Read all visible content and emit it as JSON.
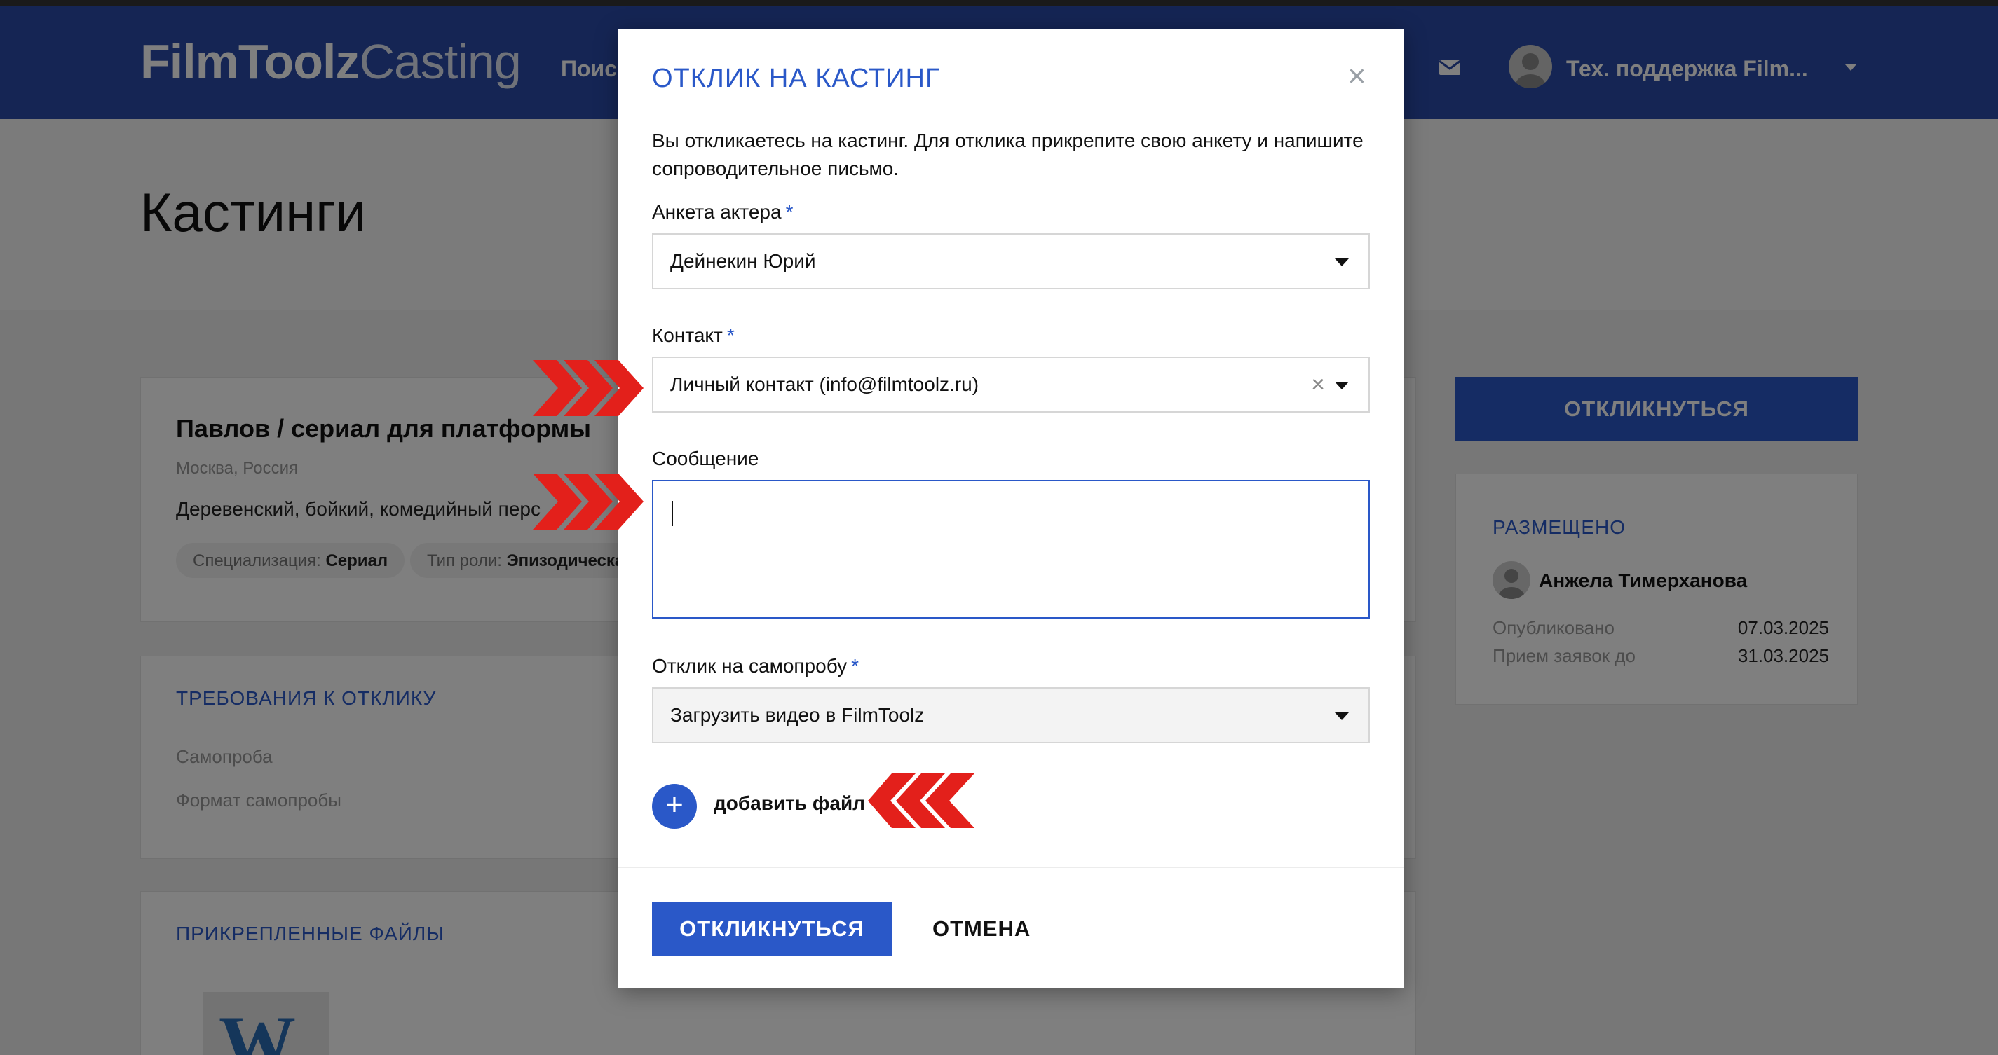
{
  "navbar": {
    "logo_bold": "FilmToolz",
    "logo_light": "Casting",
    "search_label": "Поис",
    "user_name": "Тех. поддержка Film..."
  },
  "page": {
    "title": "Кастинги"
  },
  "casting_card": {
    "title": "Павлов / сериал для платформы",
    "location": "Москва, Россия",
    "description": "Деревенский, бойкий, комедийный перс",
    "tag_specialization_label": "Специализация:",
    "tag_specialization_value": "Сериал",
    "tag_role_label": "Тип роли:",
    "tag_role_value": "Эпизодическа"
  },
  "requirements": {
    "title": "ТРЕБОВАНИЯ К ОТКЛИКУ",
    "items": [
      "Самопроба",
      "Формат самопробы"
    ]
  },
  "attachments": {
    "title": "ПРИКРЕПЛЕННЫЕ ФАЙЛЫ",
    "file_icon_letter": "W"
  },
  "sidebar": {
    "respond_label": "ОТКЛИКНУТЬСЯ",
    "posted_title": "РАЗМЕЩЕНО",
    "author": "Анжела Тимерханова",
    "published_label": "Опубликовано",
    "published_value": "07.03.2025",
    "deadline_label": "Прием заявок до",
    "deadline_value": "31.03.2025"
  },
  "modal": {
    "title": "ОТКЛИК НА КАСТИНГ",
    "close_symbol": "×",
    "intro": "Вы откликаетесь на кастинг. Для отклика прикрепите свою анкету и напишите сопроводительное письмо.",
    "profile_label": "Анкета актера",
    "profile_value": "Дейнекин Юрий",
    "contact_label": "Контакт",
    "contact_value": "Личный контакт (info@filmtoolz.ru)",
    "clear_symbol": "×",
    "message_label": "Сообщение",
    "message_value": "",
    "selftape_label": "Отклик на самопробу",
    "selftape_value": "Загрузить видео в FilmToolz",
    "add_symbol": "+",
    "add_file_label": "добавить файл",
    "submit_label": "ОТКЛИКНУТЬСЯ",
    "cancel_label": "ОТМЕНА",
    "required_mark": "*"
  },
  "colors": {
    "brand_blue": "#2a58c8",
    "navbar": "#2a4aa8",
    "annotation_red": "#e3201b"
  },
  "icons": [
    "mail-icon",
    "avatar-icon",
    "chevron-down-icon",
    "close-icon",
    "clear-icon",
    "plus-icon",
    "word-file-icon"
  ]
}
